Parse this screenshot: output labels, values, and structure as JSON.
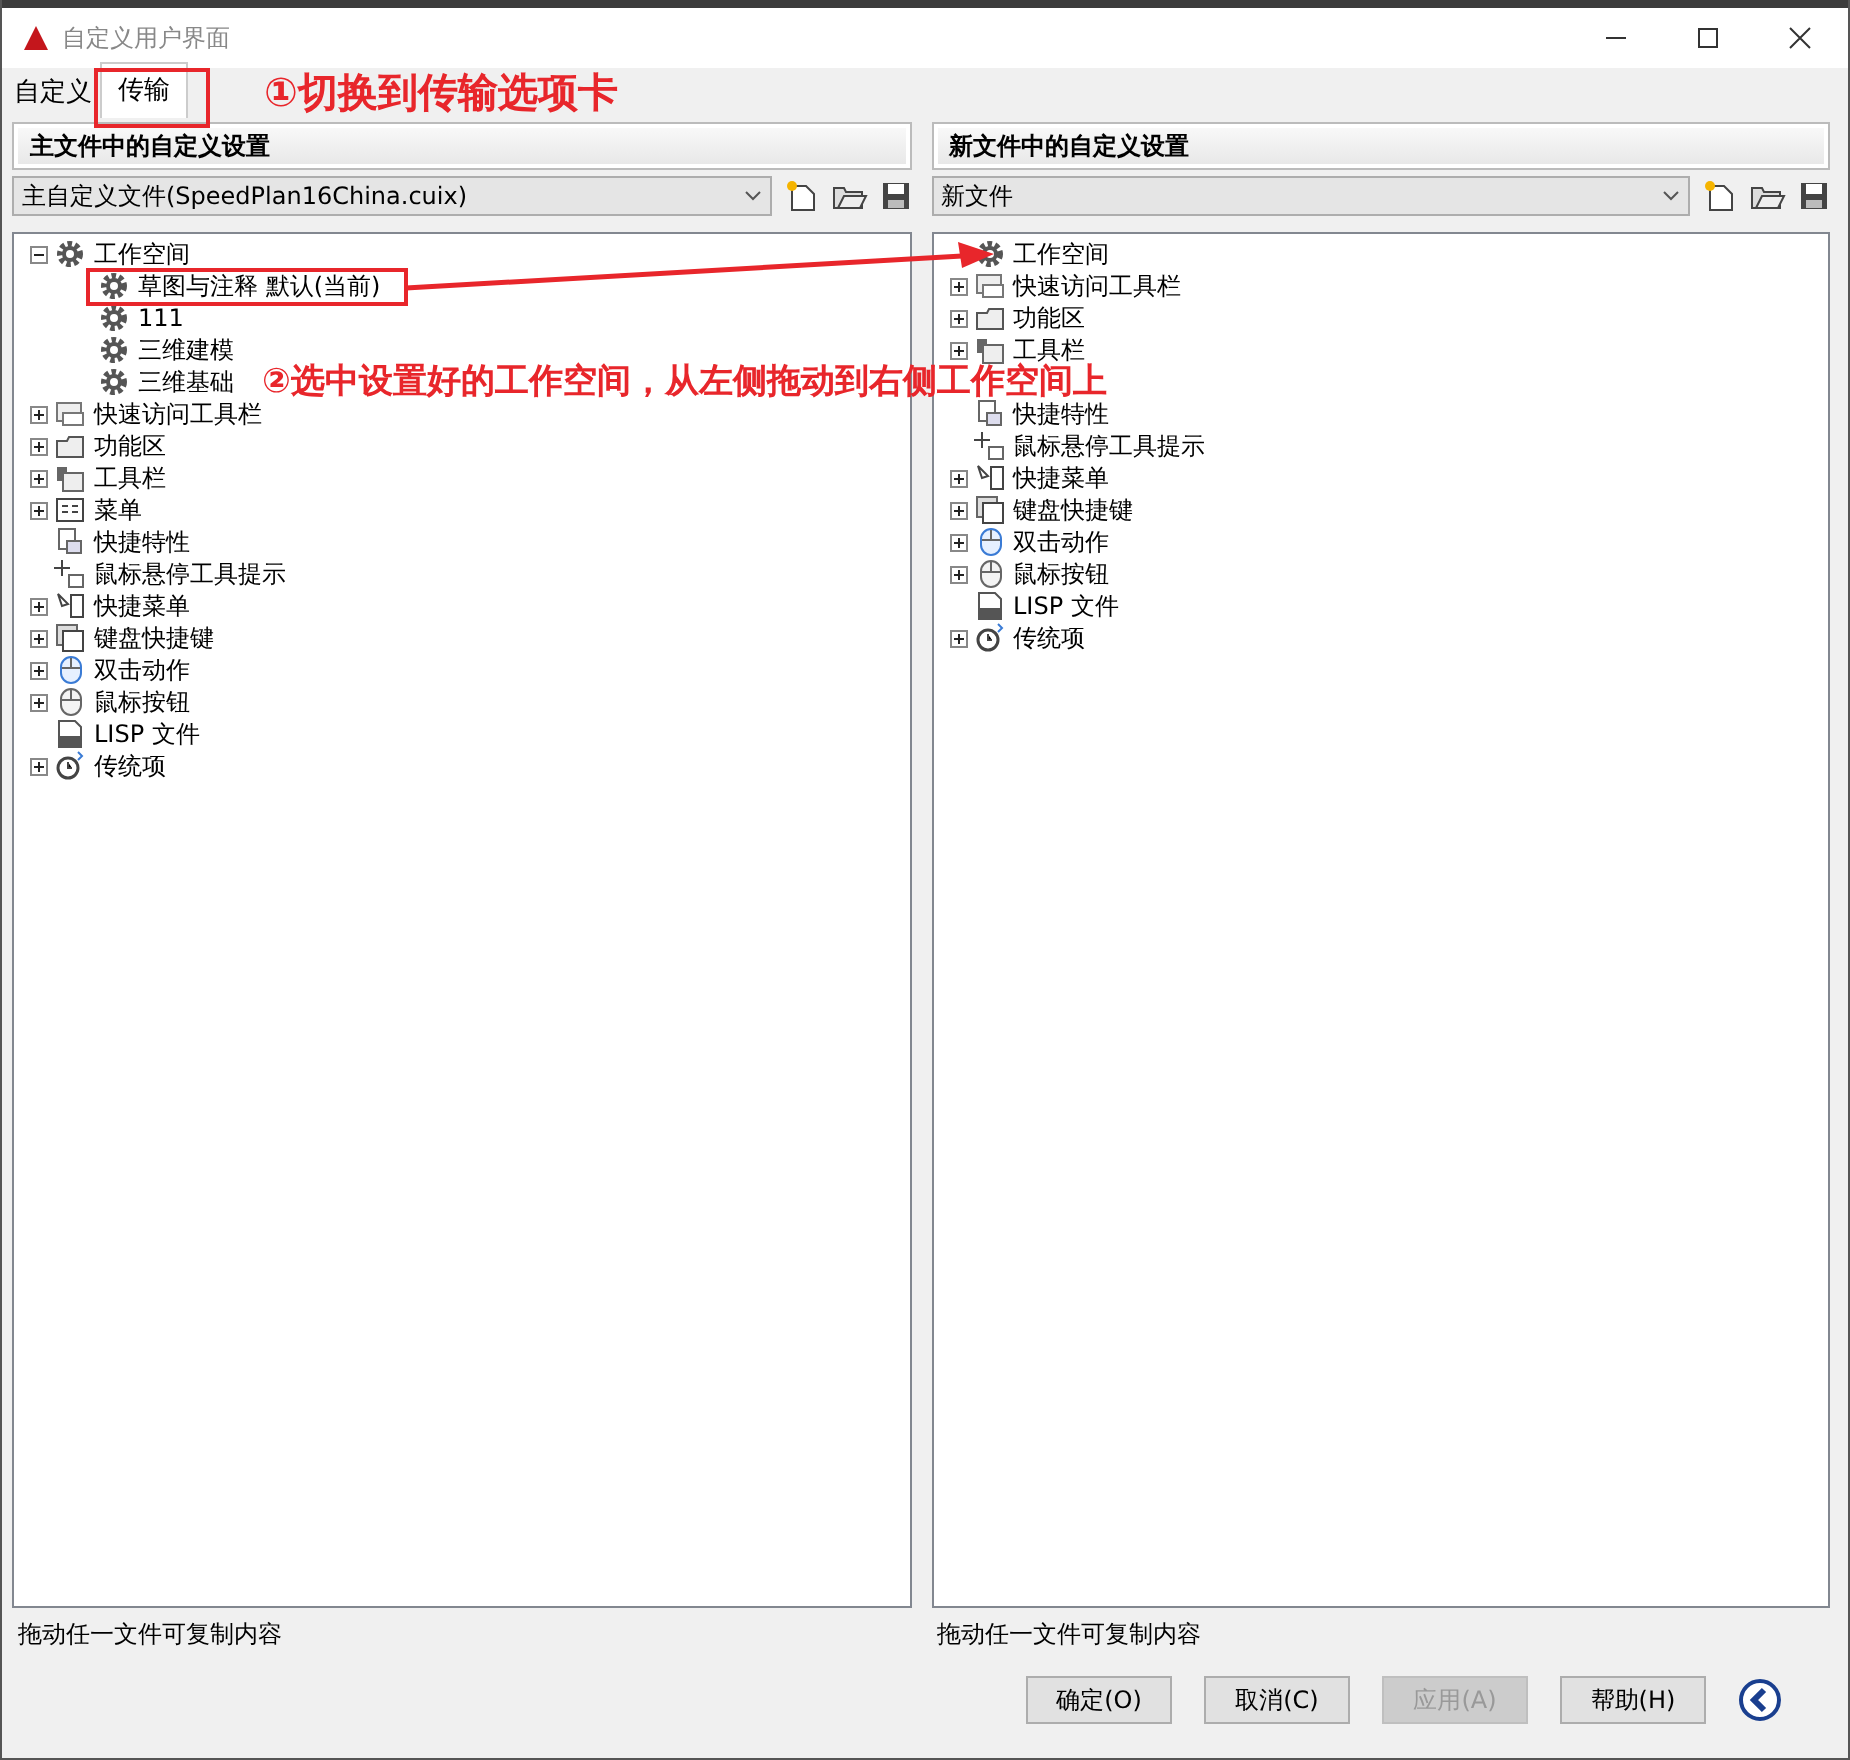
{
  "window": {
    "title": "自定义用户界面"
  },
  "tabs": [
    {
      "label": "自定义",
      "selected": false
    },
    {
      "label": "传输",
      "selected": true
    }
  ],
  "annotations": [
    "①切换到传输选项卡",
    "②选中设置好的工作空间，从左侧拖动到右侧工作空间上"
  ],
  "panels": [
    {
      "header": "主文件中的自定义设置",
      "file": "主自定义文件(SpeedPlan16China.cuix)",
      "status": "拖动任一文件可复制内容",
      "tree": [
        {
          "kind": "workspaces",
          "label": "工作空间",
          "expanded": true,
          "children": [
            {
              "kind": "workspace",
              "label": "草图与注释 默认(当前)"
            },
            {
              "kind": "workspace",
              "label": "111"
            },
            {
              "kind": "workspace",
              "label": "三维建模"
            },
            {
              "kind": "workspace",
              "label": "三维基础"
            }
          ]
        },
        {
          "kind": "qat",
          "label": "快速访问工具栏",
          "expanded": false
        },
        {
          "kind": "ribbon",
          "label": "功能区",
          "expanded": false
        },
        {
          "kind": "toolbar",
          "label": "工具栏",
          "expanded": false
        },
        {
          "kind": "menu",
          "label": "菜单",
          "expanded": false
        },
        {
          "kind": "properties",
          "label": "快捷特性"
        },
        {
          "kind": "tooltip",
          "label": "鼠标悬停工具提示"
        },
        {
          "kind": "context",
          "label": "快捷菜单",
          "expanded": false
        },
        {
          "kind": "keyboard",
          "label": "键盘快捷键",
          "expanded": false
        },
        {
          "kind": "doubleclick",
          "label": "双击动作",
          "expanded": false
        },
        {
          "kind": "mouse",
          "label": "鼠标按钮",
          "expanded": false
        },
        {
          "kind": "lisp",
          "label": "LISP 文件"
        },
        {
          "kind": "legacy",
          "label": "传统项",
          "expanded": false
        }
      ]
    },
    {
      "header": "新文件中的自定义设置",
      "file": "新文件",
      "status": "拖动任一文件可复制内容",
      "tree": [
        {
          "kind": "workspaces",
          "label": "工作空间"
        },
        {
          "kind": "qat",
          "label": "快速访问工具栏",
          "expanded": false
        },
        {
          "kind": "ribbon",
          "label": "功能区",
          "expanded": false
        },
        {
          "kind": "toolbar",
          "label": "工具栏",
          "expanded": false
        },
        {
          "kind": "covered"
        },
        {
          "kind": "properties",
          "label": "快捷特性"
        },
        {
          "kind": "tooltip",
          "label": "鼠标悬停工具提示"
        },
        {
          "kind": "context",
          "label": "快捷菜单",
          "expanded": false
        },
        {
          "kind": "keyboard",
          "label": "键盘快捷键",
          "expanded": false
        },
        {
          "kind": "doubleclick",
          "label": "双击动作",
          "expanded": false
        },
        {
          "kind": "mouse",
          "label": "鼠标按钮",
          "expanded": false
        },
        {
          "kind": "lisp",
          "label": "LISP 文件"
        },
        {
          "kind": "legacy",
          "label": "传统项",
          "expanded": false
        }
      ]
    }
  ],
  "buttons": [
    {
      "label": "确定(O)",
      "disabled": false
    },
    {
      "label": "取消(C)",
      "disabled": false
    },
    {
      "label": "应用(A)",
      "disabled": true
    },
    {
      "label": "帮助(H)",
      "disabled": false
    }
  ]
}
